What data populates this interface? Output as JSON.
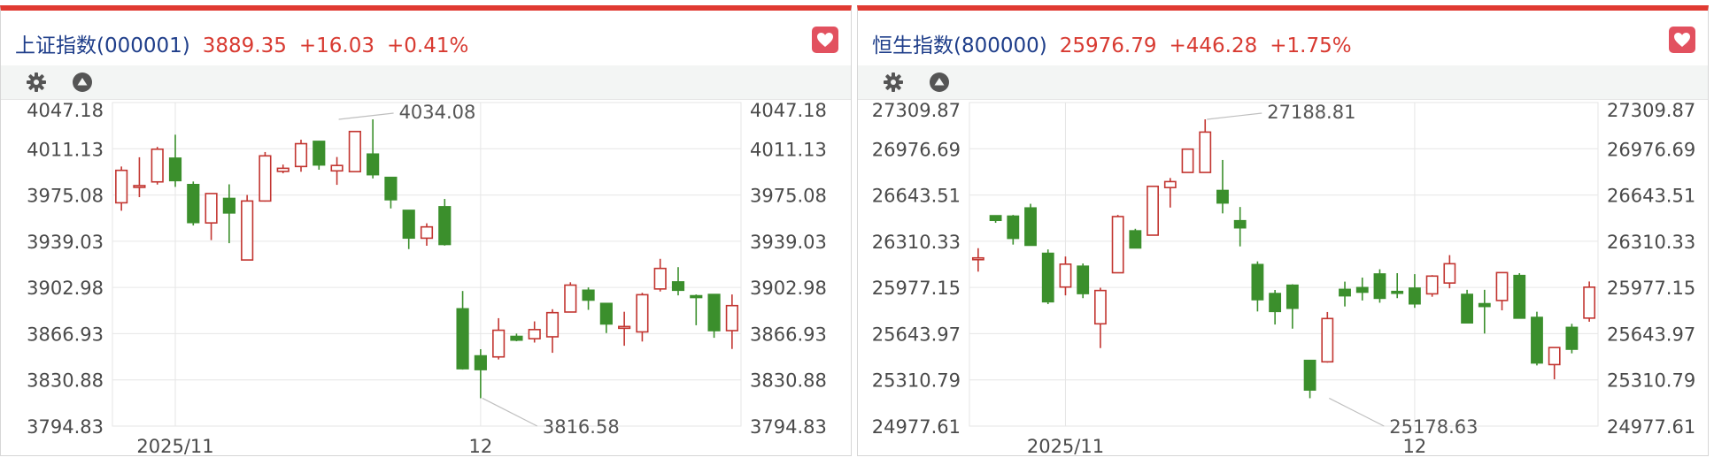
{
  "chart_data": [
    {
      "type": "candlestick",
      "index_name": "上证指数(000001)",
      "price": "3889.35",
      "change": "+16.03",
      "change_pct": "+0.41%",
      "y_axis_ticks": [
        "4047.18",
        "4011.13",
        "3975.08",
        "3939.03",
        "3902.98",
        "3866.93",
        "3830.88",
        "3794.83"
      ],
      "ylim": [
        3794.83,
        4047.18
      ],
      "x_tick_labels": [
        "2025/11",
        "12"
      ],
      "x_tick_positions": [
        3.5,
        20.5
      ],
      "high_annotation": "4034.08",
      "high_index": 12,
      "low_annotation": "3816.58",
      "low_index": 20,
      "candles": [
        {
          "o": 3969.0,
          "h": 3997.3,
          "l": 3962.8,
          "c": 3994.3
        },
        {
          "o": 3981.4,
          "h": 4004.5,
          "l": 3973.4,
          "c": 3982.4
        },
        {
          "o": 3985.3,
          "h": 4012.6,
          "l": 3983.2,
          "c": 4010.8
        },
        {
          "o": 4003.8,
          "h": 4022.1,
          "l": 3981.4,
          "c": 3986.3
        },
        {
          "o": 3983.2,
          "h": 3985.6,
          "l": 3951.3,
          "c": 3953.6
        },
        {
          "o": 3953.3,
          "h": 3976.5,
          "l": 3939.9,
          "c": 3976.2
        },
        {
          "o": 3972.4,
          "h": 3983.4,
          "l": 3937.5,
          "c": 3961.1
        },
        {
          "o": 3924.4,
          "h": 3975.1,
          "l": 3924.4,
          "c": 3970.4
        },
        {
          "o": 3970.4,
          "h": 4008.6,
          "l": 3969.9,
          "c": 4005.6
        },
        {
          "o": 3993.5,
          "h": 3998.8,
          "l": 3992.0,
          "c": 3995.9
        },
        {
          "o": 3997.3,
          "h": 4018.2,
          "l": 3993.2,
          "c": 4015.1
        },
        {
          "o": 4016.9,
          "h": 4017.3,
          "l": 3994.8,
          "c": 3998.5
        },
        {
          "o": 3993.9,
          "h": 4004.7,
          "l": 3983.0,
          "c": 3998.1
        },
        {
          "o": 3993.3,
          "h": 4024.6,
          "l": 3993.3,
          "c": 4024.6
        },
        {
          "o": 4007.0,
          "h": 4034.08,
          "l": 3988.0,
          "c": 3990.9
        },
        {
          "o": 3988.8,
          "h": 3988.8,
          "l": 3964.6,
          "c": 3971.4
        },
        {
          "o": 3963.1,
          "h": 3963.1,
          "l": 3932.9,
          "c": 3941.5
        },
        {
          "o": 3941.4,
          "h": 3953.0,
          "l": 3935.5,
          "c": 3950.2
        },
        {
          "o": 3965.9,
          "h": 3972.0,
          "l": 3935.6,
          "c": 3936.5
        },
        {
          "o": 3886.3,
          "h": 3900.2,
          "l": 3838.9,
          "c": 3839.6
        },
        {
          "o": 3849.6,
          "h": 3854.8,
          "l": 3816.58,
          "c": 3838.9
        },
        {
          "o": 3848.8,
          "h": 3879.0,
          "l": 3846.8,
          "c": 3869.6
        },
        {
          "o": 3864.8,
          "h": 3867.0,
          "l": 3861.0,
          "c": 3861.9
        },
        {
          "o": 3863.0,
          "h": 3876.5,
          "l": 3860.0,
          "c": 3870.1
        },
        {
          "o": 3864.5,
          "h": 3886.0,
          "l": 3852.0,
          "c": 3883.3
        },
        {
          "o": 3883.8,
          "h": 3907.0,
          "l": 3883.8,
          "c": 3904.8
        },
        {
          "o": 3900.8,
          "h": 3903.0,
          "l": 3885.5,
          "c": 3893.1
        },
        {
          "o": 3890.5,
          "h": 3890.5,
          "l": 3867.4,
          "c": 3874.5
        },
        {
          "o": 3872.5,
          "h": 3884.0,
          "l": 3857.5,
          "c": 3872.5
        },
        {
          "o": 3868.3,
          "h": 3898.8,
          "l": 3860.8,
          "c": 3897.3
        },
        {
          "o": 3901.8,
          "h": 3925.3,
          "l": 3899.8,
          "c": 3917.8
        },
        {
          "o": 3907.3,
          "h": 3918.8,
          "l": 3896.8,
          "c": 3900.8
        },
        {
          "o": 3896.5,
          "h": 3897.5,
          "l": 3873.5,
          "c": 3895.5
        },
        {
          "o": 3897.5,
          "h": 3897.5,
          "l": 3863.7,
          "c": 3869.3
        },
        {
          "o": 3869.3,
          "h": 3897.5,
          "l": 3855.0,
          "c": 3888.8
        }
      ]
    },
    {
      "type": "candlestick",
      "index_name": "恒生指数(800000)",
      "price": "25976.79",
      "change": "+446.28",
      "change_pct": "+1.75%",
      "y_axis_ticks": [
        "27309.87",
        "26976.69",
        "26643.51",
        "26310.33",
        "25977.15",
        "25643.97",
        "25310.79",
        "24977.61"
      ],
      "ylim": [
        24977.61,
        27309.87
      ],
      "x_tick_labels": [
        "2025/11",
        "12"
      ],
      "x_tick_positions": [
        5.5,
        25.5
      ],
      "high_annotation": "27188.81",
      "high_index": 13,
      "low_annotation": "25178.63",
      "low_index": 20,
      "candles": [
        {
          "o": 26189.0,
          "h": 26260.0,
          "l": 26091.0,
          "c": 26190.0
        },
        {
          "o": 26494.0,
          "h": 26497.0,
          "l": 26443.0,
          "c": 26461.0
        },
        {
          "o": 26491.0,
          "h": 26500.0,
          "l": 26286.0,
          "c": 26331.0
        },
        {
          "o": 26550.0,
          "h": 26580.0,
          "l": 26310.0,
          "c": 26281.0
        },
        {
          "o": 26223.0,
          "h": 26251.0,
          "l": 25857.0,
          "c": 25874.0
        },
        {
          "o": 25980.0,
          "h": 26200.0,
          "l": 25920.0,
          "c": 26145.0
        },
        {
          "o": 26130.0,
          "h": 26150.0,
          "l": 25900.0,
          "c": 25933.0
        },
        {
          "o": 25715.0,
          "h": 25975.0,
          "l": 25540.0,
          "c": 25955.0
        },
        {
          "o": 26083.0,
          "h": 26500.0,
          "l": 26083.0,
          "c": 26488.0
        },
        {
          "o": 26385.0,
          "h": 26400.0,
          "l": 26260.0,
          "c": 26262.0
        },
        {
          "o": 26354.0,
          "h": 26706.0,
          "l": 26354.0,
          "c": 26706.0
        },
        {
          "o": 26697.0,
          "h": 26766.0,
          "l": 26553.0,
          "c": 26740.0
        },
        {
          "o": 26806.0,
          "h": 26963.0,
          "l": 26806.0,
          "c": 26974.0
        },
        {
          "o": 26806.0,
          "h": 27188.81,
          "l": 26806.0,
          "c": 27097.0
        },
        {
          "o": 26676.0,
          "h": 26896.0,
          "l": 26511.0,
          "c": 26586.0
        },
        {
          "o": 26458.0,
          "h": 26557.0,
          "l": 26273.0,
          "c": 26407.0
        },
        {
          "o": 26142.0,
          "h": 26165.0,
          "l": 25804.0,
          "c": 25889.0
        },
        {
          "o": 25933.0,
          "h": 25959.0,
          "l": 25710.0,
          "c": 25804.0
        },
        {
          "o": 25993.0,
          "h": 26000.0,
          "l": 25680.0,
          "c": 25827.0
        },
        {
          "o": 25451.0,
          "h": 25451.0,
          "l": 25178.63,
          "c": 25238.0
        },
        {
          "o": 25441.0,
          "h": 25800.0,
          "l": 25435.0,
          "c": 25753.0
        },
        {
          "o": 25963.0,
          "h": 26019.0,
          "l": 25840.0,
          "c": 25917.0
        },
        {
          "o": 25976.0,
          "h": 26048.0,
          "l": 25883.0,
          "c": 25943.0
        },
        {
          "o": 26074.0,
          "h": 26108.0,
          "l": 25867.0,
          "c": 25899.0
        },
        {
          "o": 25948.0,
          "h": 26080.0,
          "l": 25900.0,
          "c": 25944.0
        },
        {
          "o": 25972.0,
          "h": 26073.0,
          "l": 25830.0,
          "c": 25859.0
        },
        {
          "o": 25931.0,
          "h": 26066.0,
          "l": 25910.0,
          "c": 26059.0
        },
        {
          "o": 26009.0,
          "h": 26210.0,
          "l": 25971.0,
          "c": 26148.0
        },
        {
          "o": 25927.0,
          "h": 25960.0,
          "l": 25745.0,
          "c": 25722.0
        },
        {
          "o": 25860.0,
          "h": 25960.0,
          "l": 25645.0,
          "c": 25840.0
        },
        {
          "o": 25883.0,
          "h": 26084.0,
          "l": 25812.0,
          "c": 26084.0
        },
        {
          "o": 26063.0,
          "h": 26080.0,
          "l": 25771.0,
          "c": 25756.0
        },
        {
          "o": 25761.0,
          "h": 25802.0,
          "l": 25415.0,
          "c": 25433.0
        },
        {
          "o": 25421.0,
          "h": 25544.0,
          "l": 25315.0,
          "c": 25544.0
        },
        {
          "o": 25689.0,
          "h": 25715.0,
          "l": 25502.0,
          "c": 25532.0
        },
        {
          "o": 25756.0,
          "h": 26020.0,
          "l": 25730.0,
          "c": 25979.0
        }
      ]
    }
  ],
  "colors": {
    "up": "#c23530",
    "down": "#3b8f2c",
    "title_blue": "#1f3e8a",
    "quote_red": "#d83a31",
    "top_bar": "#e03a32",
    "favorite_bg": "#e2515f",
    "grid": "#e6e6e6",
    "axis_text": "#4a4a4a"
  },
  "icons": {
    "settings": "gear-icon",
    "collapse": "triangle-up-icon",
    "favorite": "heart-icon"
  }
}
